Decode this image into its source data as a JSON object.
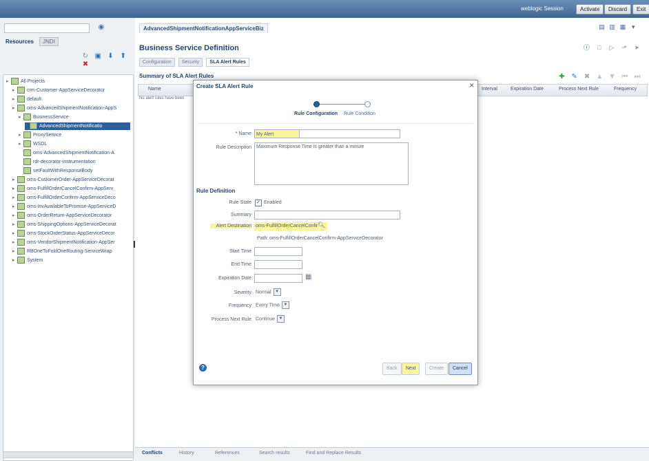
{
  "topbar": {
    "session": "weblogic Session",
    "buttons": [
      "Activate",
      "Discard",
      "Exit"
    ]
  },
  "left": {
    "tabs": [
      "Resources",
      "JNDI"
    ],
    "tree": [
      {
        "label": "All Projects",
        "level": 0,
        "selected": false
      },
      {
        "label": "crm-Customer-AppServiceDecorator",
        "level": 1,
        "selected": false
      },
      {
        "label": "default",
        "level": 1,
        "selected": false
      },
      {
        "label": "oms-AdvancedShipmentNotification-AppS",
        "level": 1,
        "selected": false
      },
      {
        "label": "BusinessService",
        "level": 2,
        "selected": false
      },
      {
        "label": "AdvancedShipmentNotificatio",
        "level": 3,
        "selected": true
      },
      {
        "label": "ProxyService",
        "level": 2,
        "selected": false
      },
      {
        "label": "WSDL",
        "level": 2,
        "selected": false
      },
      {
        "label": "oms-AdvancedShipmentNotification-A",
        "level": 2,
        "selected": false
      },
      {
        "label": "rdr-decorator-instrumentation",
        "level": 2,
        "selected": false
      },
      {
        "label": "setFaultWithResponseBody",
        "level": 2,
        "selected": false
      },
      {
        "label": "oms-CustomerOrder-AppServiceDecorat",
        "level": 1,
        "selected": false
      },
      {
        "label": "oms-FulfillOrderCancelConfirm-AppServ",
        "level": 1,
        "selected": false
      },
      {
        "label": "oms-FulfillOrderConfirm-AppServiceDeco",
        "level": 1,
        "selected": false
      },
      {
        "label": "oms-InvAvailableToPromise-AppServiceD",
        "level": 1,
        "selected": false
      },
      {
        "label": "oms-OrderReturn-AppServiceDecorator",
        "level": 1,
        "selected": false
      },
      {
        "label": "oms-ShippingOptions-AppServiceDecorat",
        "level": 1,
        "selected": false
      },
      {
        "label": "oms-StockOrderStatus-AppServiceDecor",
        "level": 1,
        "selected": false
      },
      {
        "label": "oms-VendorShipmentNotification-AppSer",
        "level": 1,
        "selected": false
      },
      {
        "label": "RBOneToFoldOneRouting-ServiceWrap",
        "level": 1,
        "selected": false
      },
      {
        "label": "System",
        "level": 1,
        "selected": false
      }
    ]
  },
  "main": {
    "doc_tab": "AdvancedShipmentNotificationAppServiceBiz",
    "title": "Business Service Definition",
    "subtabs": [
      "Configuration",
      "Security",
      "SLA Alert Rules"
    ],
    "summary": "Summary of SLA Alert Rules",
    "columns": [
      "Name",
      "Interval",
      "Expiration Date",
      "Process Next Rule",
      "Frequency"
    ],
    "no_rows": "No alert rules have been",
    "bottom_tabs": [
      "Conflicts",
      "History",
      "References",
      "Search results",
      "Find and Replace Results"
    ]
  },
  "dialog": {
    "title": "Create SLA Alert Rule",
    "steps": [
      "Rule Configuration",
      "Rule Condition"
    ],
    "name_label": "* Name",
    "name_value": "My Alert",
    "desc_label": "Rule Description",
    "desc_value": "Maximum Response Time is greater than a minute",
    "section": "Rule Definition",
    "state_label": "Rule State",
    "state_value": "Enabled",
    "summary_label": "Summary",
    "dest_label": "Alert Destination",
    "dest_value": "oms-FulfillOrderCancelConfir",
    "path_label": "Path:",
    "path_value": "oms-FulfillOrderCancelConfirm-AppServiceDecorator",
    "start_label": "Start Time",
    "end_label": "End Time",
    "exp_label": "Expiration Date",
    "severity_label": "Severity",
    "severity_value": "Normal",
    "frequency_label": "Frequency",
    "frequency_value": "Every Time",
    "pnr_label": "Process Next Rule",
    "pnr_value": "Continue",
    "buttons": {
      "back": "Back",
      "next": "Next",
      "create": "Create",
      "cancel": "Cancel"
    }
  }
}
